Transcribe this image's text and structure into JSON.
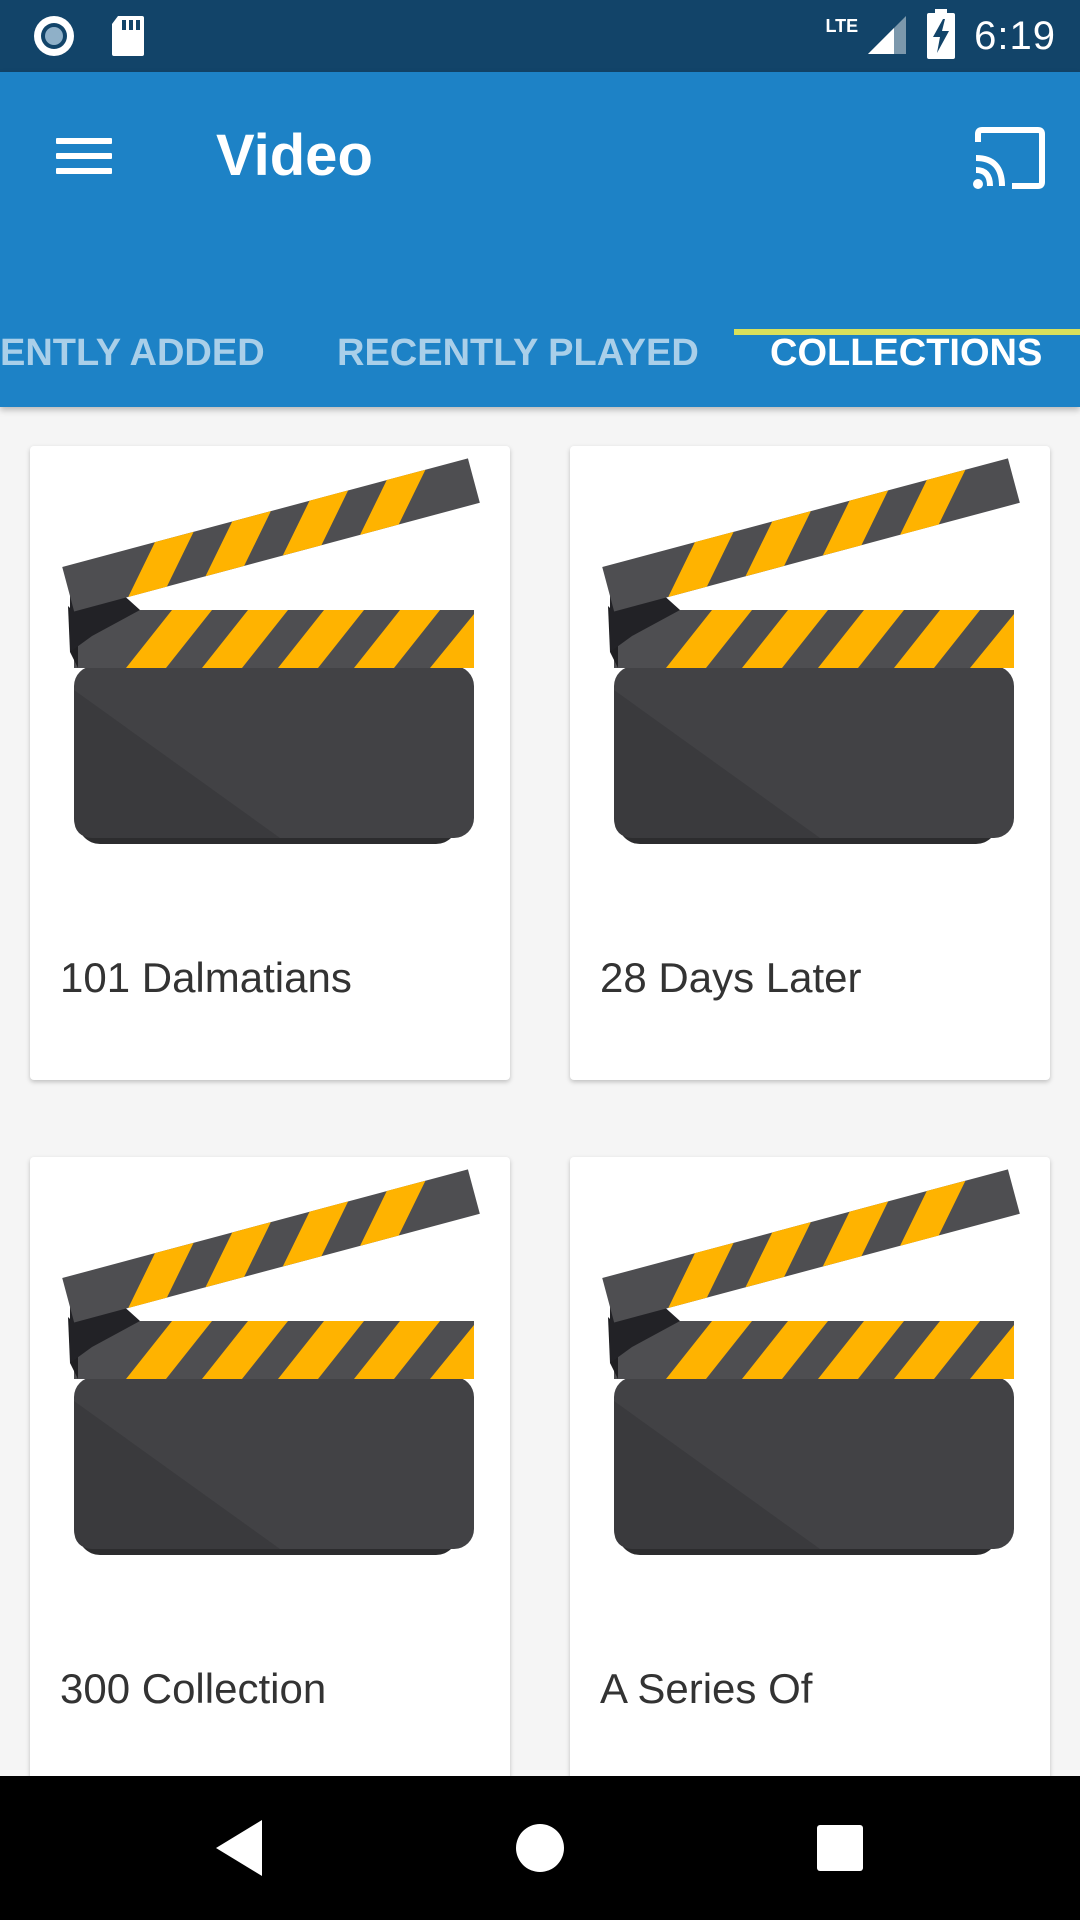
{
  "status_bar": {
    "time": "6:19",
    "network": "LTE"
  },
  "app_bar": {
    "title": "Video"
  },
  "tabs": [
    {
      "label": "ENTLY ADDED"
    },
    {
      "label": "RECENTLY PLAYED"
    },
    {
      "label": "COLLECTIONS",
      "active": true
    }
  ],
  "collections": [
    {
      "title": "101 Dalmatians",
      "icon": "clapperboard-icon"
    },
    {
      "title": "28 Days Later",
      "icon": "clapperboard-icon"
    },
    {
      "title": "300 Collection",
      "icon": "clapperboard-icon"
    },
    {
      "title": "A Series Of",
      "icon": "clapperboard-icon"
    }
  ],
  "icons": {
    "menu": "menu-icon",
    "cast": "cast-icon",
    "nav": [
      "back-icon",
      "home-icon",
      "recents-icon"
    ]
  },
  "colors": {
    "status_bar": "#124469",
    "app_bar": "#1d82c6",
    "tab_indicator": "#d9e05b",
    "clapper_stripe": "#ffb300",
    "clapper_body": "#424245"
  }
}
